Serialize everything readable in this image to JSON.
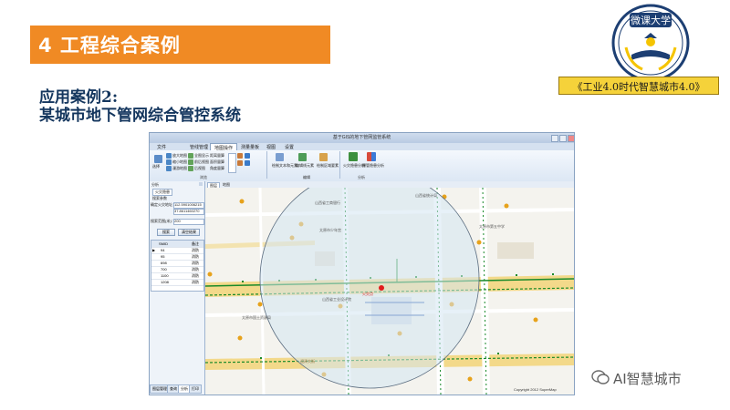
{
  "slide": {
    "section_title": "4 工程综合案例",
    "subtitle_line1": "应用案例2:",
    "subtitle_line2": "某城市地下管网综合管控系统",
    "logo_text": "微课大学",
    "tag": "《工业4.0时代智慧城市4.0》",
    "watermark": "AI智慧城市"
  },
  "app": {
    "title": "基于GIS的地下管网监管系统",
    "menus": [
      "文件",
      "管线管理",
      "地图操作",
      "测量量板",
      "视图",
      "设置"
    ],
    "active_menu": "地图操作",
    "ribbon": {
      "nav_buttons": [
        "选择",
        "放大地图",
        "缩小地图",
        "漫游地图",
        "全图显示",
        "前后视图",
        "后视图"
      ],
      "measure_items": [
        "距离量算",
        "面积量算",
        "角度量算"
      ],
      "group1_label": "浏览",
      "tool_buttons": [
        "绘制文本",
        "绘制线",
        "绘制区域"
      ],
      "tool_labels": [
        "绘制文本和元素",
        "编辑线元素",
        "绘制区域要素"
      ],
      "group2_label": "编辑",
      "analysis_buttons": [
        "火灾隐患分析",
        "爆管隐患分析"
      ],
      "group3_label": "分析"
    },
    "panel": {
      "header": "分析",
      "tab": "火灾隐患",
      "subtitle": "搜索参数",
      "coord_label": "确定火灾地址：",
      "x_value": "112.5901006215",
      "y_value": "37.8611460270",
      "radius_label": "搜索范围(米)：",
      "radius_value": "200",
      "btn_search": "搜索",
      "btn_clear": "清空结果",
      "columns": [
        "SMID",
        "备注"
      ],
      "rows": [
        {
          "id": "94",
          "note": "消防"
        },
        {
          "id": "95",
          "note": "消防"
        },
        {
          "id": "698",
          "note": "消防"
        },
        {
          "id": "700",
          "note": "消防"
        },
        {
          "id": "1100",
          "note": "消防"
        },
        {
          "id": "1208",
          "note": "消防"
        }
      ],
      "bottom_tabs": [
        "图层管理",
        "查询",
        "分析",
        "打印"
      ]
    },
    "map_tabs": [
      "图层",
      "地图"
    ],
    "map_labels": [
      "山西省工商银行",
      "山西省统计局",
      "太原市少年宫",
      "火灾点",
      "山西省工业设计院",
      "太原市第五中学",
      "太原市国土资源局",
      "迎泽大街"
    ],
    "fire_label": "火灾点",
    "copyright": "Copyright 2012 SuperMap"
  },
  "colors": {
    "accent_orange": "#f08a24",
    "navy": "#14365e",
    "road": "#f3d98a",
    "pipe_green": "#1a8a2a"
  }
}
